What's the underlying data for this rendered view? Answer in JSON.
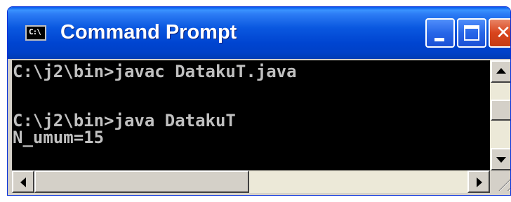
{
  "window": {
    "title": "Command Prompt",
    "icon_label": "C:\\",
    "icon": "console-icon"
  },
  "controls": {
    "minimize_icon": "minimize-icon",
    "maximize_icon": "maximize-icon",
    "close_icon": "close-icon",
    "close_glyph": "✕"
  },
  "console": {
    "lines": [
      "C:\\j2\\bin>javac DatakuT.java",
      "C:\\j2\\bin>java DatakuT",
      "N_umum=15"
    ]
  },
  "colors": {
    "titlebar": "#0058ee",
    "console_bg": "#000000",
    "console_text": "#c0c0c0",
    "close_button": "#d9441c"
  }
}
